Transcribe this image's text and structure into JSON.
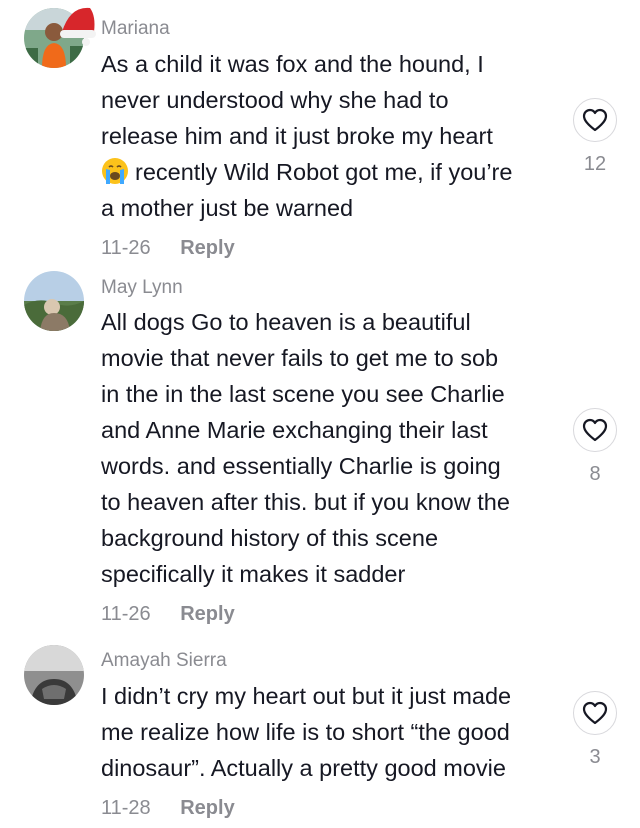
{
  "comments": [
    {
      "author": "Mariana",
      "lines": [
        "As a child it was fox and the hound, I",
        "never understood why she had to",
        "release him and it just broke my heart",
        "recently Wild Robot got me, if you’re",
        "a mother just be warned"
      ],
      "emoji": "crying-face",
      "date": "11-26",
      "reply_label": "Reply",
      "likes": "12"
    },
    {
      "author": "May Lynn",
      "lines": [
        "All dogs Go to heaven is a beautiful",
        "movie that never fails to get me to sob",
        "in the in the last scene you see Charlie",
        "and Anne Marie exchanging their last",
        "words. and essentially Charlie is going",
        "to heaven after this. but if you know the",
        "background history of this scene",
        "specifically it makes it sadder"
      ],
      "date": "11-26",
      "reply_label": "Reply",
      "likes": "8"
    },
    {
      "author": "Amayah Sierra",
      "lines": [
        "I didn’t cry my heart out but it just made",
        "me realize how life is to short “the good",
        "dinosaur”. Actually a pretty good movie"
      ],
      "date": "11-28",
      "reply_label": "Reply",
      "likes": "3"
    }
  ],
  "colors": {
    "text": "#161823",
    "muted": "#8a8b91",
    "border": "#d8d8dc"
  }
}
